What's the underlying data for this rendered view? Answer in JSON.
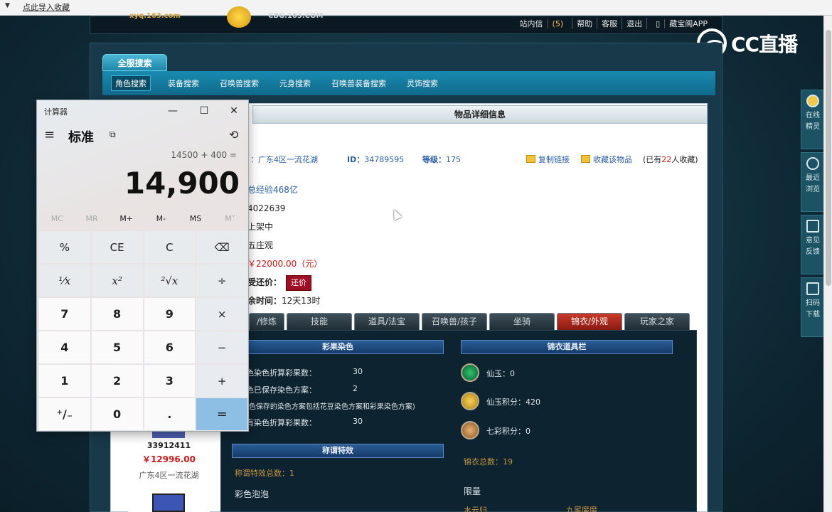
{
  "browser": {
    "bookmark_import": "点此导入收藏"
  },
  "header": {
    "logo_text": "xyq.163.com",
    "site_text": "CBG.163.COM",
    "nav": {
      "messages": "站内信",
      "messages_count": "(5)",
      "help": "帮助",
      "service": "客服",
      "logout": "退出",
      "app": "藏宝阁APP"
    }
  },
  "watermark": {
    "text": "CC直播"
  },
  "search": {
    "top_tab": "全服搜索",
    "subtabs": [
      "角色搜索",
      "装备搜索",
      "召唤兽搜索",
      "元身搜索",
      "召唤兽装备搜索",
      "灵饰搜索"
    ]
  },
  "item": {
    "title": "物品详细信息",
    "server": "：广东4区一流花湖",
    "id_label": "ID：",
    "id_value": "34789595",
    "level_label": "等级：",
    "level_value": "175",
    "copy_link": "复制链接",
    "favorite": "收藏该物品",
    "fav_count_prefix": "(已有",
    "fav_count": "22",
    "fav_count_suffix": "人收藏)",
    "exp": "总经验468亿",
    "line2": "4022639",
    "status": "上架中",
    "school": "五庄观",
    "price": "￥22000.00（元）",
    "haggle_label": "受还价：",
    "haggle_button": "还价",
    "time_label": "余时间：",
    "time_value": "12天13时"
  },
  "game_tabs": [
    "/修炼",
    "技能",
    "道具/法宝",
    "召唤兽/孩子",
    "坐骑",
    "锦衣/外观",
    "玩家之家"
  ],
  "dye": {
    "section_title": "彩果染色",
    "rows": [
      {
        "label": "色染色折算彩果数：",
        "value": "30"
      },
      {
        "label": "色已保存染色方案：",
        "value": "2"
      }
    ],
    "note": "(色保存的染色方案包括花豆染色方案和彩果染色方案)",
    "row3_label": "有染色折算彩果数：",
    "row3_value": "30"
  },
  "title_effect": {
    "section_title": "称谓特效",
    "total": "称谓特效总数：1",
    "item": "彩色泡泡"
  },
  "wardrobe": {
    "section_title": "锦衣道具栏",
    "xianyu": "仙玉：0",
    "xianyu_points": "仙玉积分：420",
    "qicai_points": "七彩积分：0",
    "total": "锦衣总数：19",
    "limited": "限量",
    "item1": "水云归",
    "item2": "九尾魔魔"
  },
  "left_card": {
    "id": "33912411",
    "price": "￥12996.00",
    "server": "广东4区一流花湖"
  },
  "right_side": [
    {
      "label1": "在线",
      "label2": "精灵"
    },
    {
      "label1": "最近",
      "label2": "浏览"
    },
    {
      "label1": "意见",
      "label2": "反馈"
    },
    {
      "label1": "扫码",
      "label2": "下载"
    }
  ],
  "calculator": {
    "title": "计算器",
    "minimize": "—",
    "maximize": "☐",
    "close": "✕",
    "menu": "≡",
    "mode": "标准",
    "keep_on_top": "⧉",
    "history": "⟲",
    "expression": "14500 + 400 =",
    "display": "14,900",
    "memory": [
      "MC",
      "MR",
      "M+",
      "M-",
      "MS",
      "M˅"
    ],
    "keys": [
      "%",
      "CE",
      "C",
      "⌫",
      "¹⁄x",
      "x²",
      "²√x",
      "÷",
      "7",
      "8",
      "9",
      "×",
      "4",
      "5",
      "6",
      "−",
      "1",
      "2",
      "3",
      "+",
      "⁺/₋",
      "0",
      ".",
      "="
    ]
  }
}
